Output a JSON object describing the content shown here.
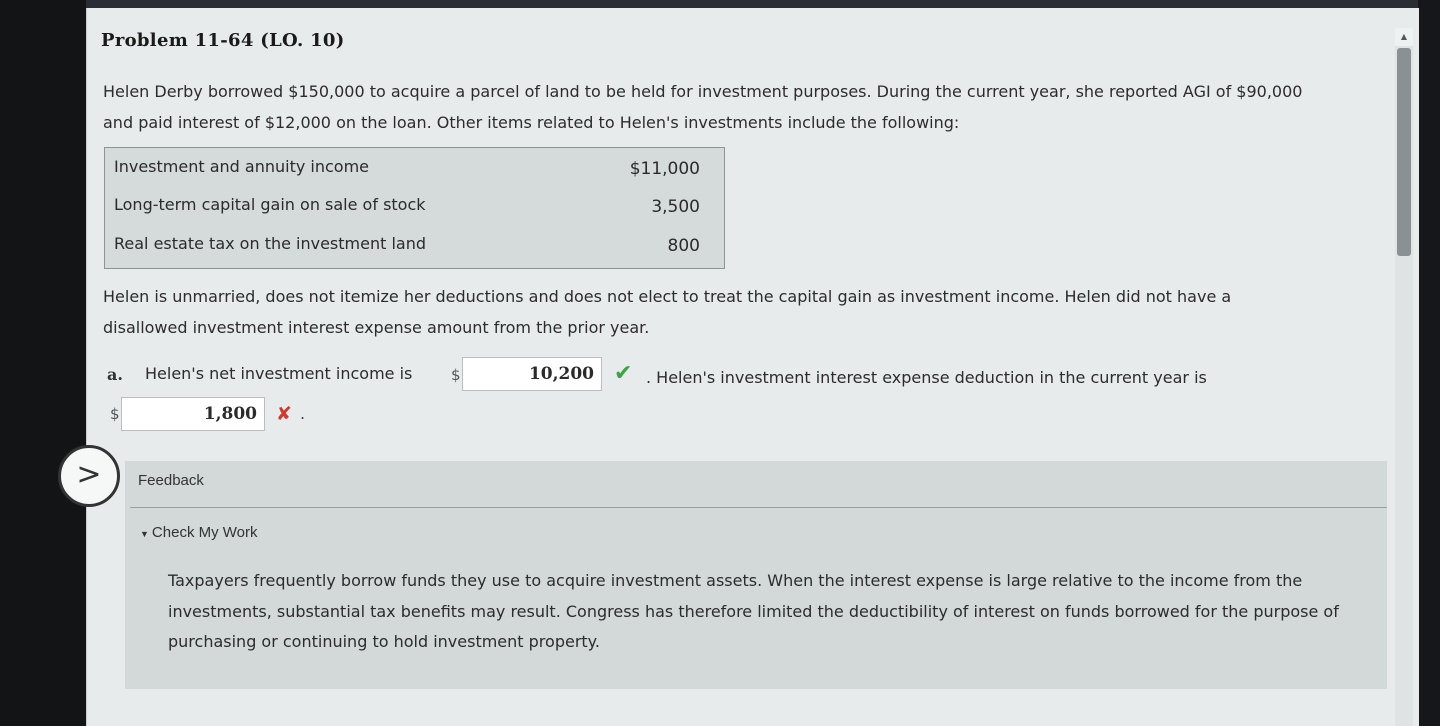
{
  "problem": {
    "title": "Problem 11-64 (LO. 10)",
    "intro": "Helen Derby borrowed $150,000 to acquire a parcel of land to be held for investment purposes. During the current year, she reported AGI of $90,000 and paid interest of $12,000 on the loan. Other items related to Helen's investments include the following:",
    "items": [
      {
        "label": "Investment and annuity income",
        "value": "$11,000"
      },
      {
        "label": "Long-term capital gain on sale of stock",
        "value": "3,500"
      },
      {
        "label": "Real estate tax on the investment land",
        "value": "800"
      }
    ],
    "condition": "Helen is unmarried, does not itemize her deductions and does not elect to treat the capital gain as investment income. Helen did not have a disallowed investment interest expense amount from the prior year."
  },
  "question_a": {
    "letter": "a.",
    "text_before": "Helen's net investment income is",
    "currency": "$",
    "answer1": "10,200",
    "answer1_status": "correct",
    "text_middle": ". Helen's investment interest expense deduction in the current year is",
    "answer2": "1,800",
    "answer2_status": "incorrect",
    "text_end": "."
  },
  "feedback": {
    "toggle_glyph": ">",
    "label": "Feedback",
    "check_my_work": "Check My Work",
    "text": "Taxpayers frequently borrow funds they use to acquire investment assets. When the interest expense is large relative to the income from the investments, substantial tax benefits may result. Congress has therefore limited the deductibility of interest on funds borrowed for the purpose of purchasing or continuing to hold investment property."
  },
  "icons": {
    "correct": "check-icon",
    "incorrect": "x-icon",
    "expand": "chevron-right-icon",
    "collapse": "triangle-down-icon"
  },
  "colors": {
    "correct": "#3aa346",
    "incorrect": "#d03a32",
    "page_bg": "#e7ebeb",
    "feedback_bg": "#d3d8d8"
  }
}
